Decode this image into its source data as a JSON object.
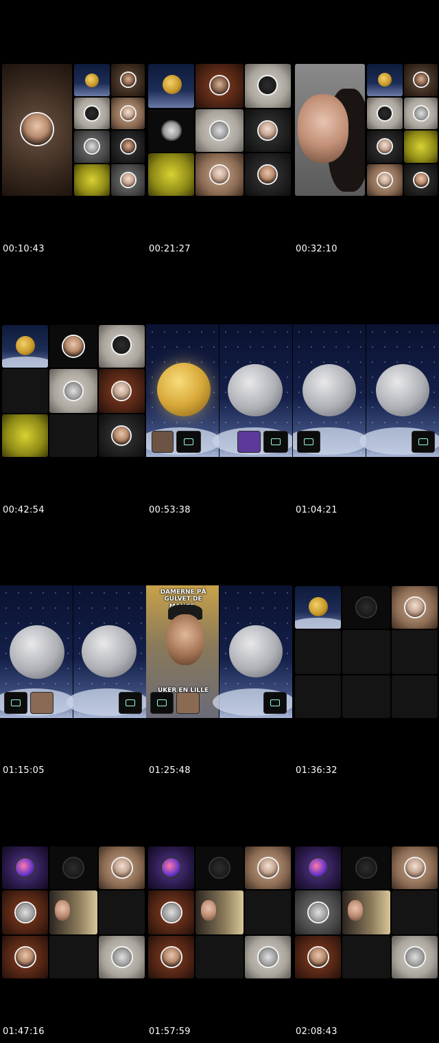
{
  "frames": [
    {
      "timestamp": "00:10:43"
    },
    {
      "timestamp": "00:21:27"
    },
    {
      "timestamp": "00:32:10"
    },
    {
      "timestamp": "00:42:54"
    },
    {
      "timestamp": "00:53:38"
    },
    {
      "timestamp": "01:04:21"
    },
    {
      "timestamp": "01:15:05"
    },
    {
      "timestamp": "01:25:48"
    },
    {
      "timestamp": "01:36:32"
    },
    {
      "timestamp": "01:47:16"
    },
    {
      "timestamp": "01:57:59"
    },
    {
      "timestamp": "02:08:43"
    }
  ],
  "overlay": {
    "caption_top": "DAMERNE PÅ GULVET DE MANGE.",
    "caption_bottom": "UKER EN LILLE"
  }
}
